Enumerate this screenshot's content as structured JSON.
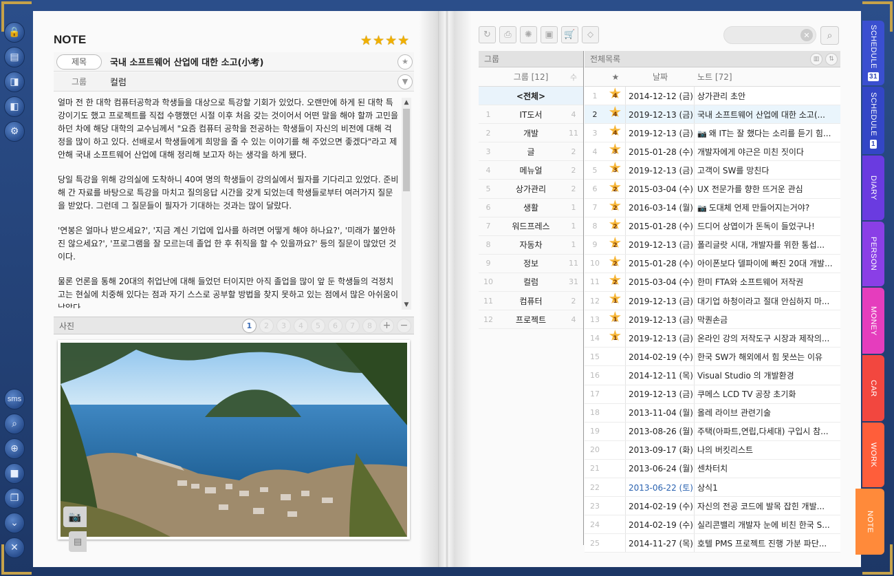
{
  "left_tools": [
    {
      "name": "lock-icon",
      "glyph": "🔒"
    },
    {
      "name": "book-icon",
      "glyph": "▤"
    },
    {
      "name": "page-right-icon",
      "glyph": "◨"
    },
    {
      "name": "page-left-icon",
      "glyph": "◧"
    },
    {
      "name": "gear-icon",
      "glyph": "⚙"
    }
  ],
  "left_tools_bottom": [
    {
      "name": "sms-button",
      "label": "sms"
    },
    {
      "name": "search-icon",
      "label": "⌕"
    },
    {
      "name": "zoom-settings-icon",
      "label": "⊕"
    },
    {
      "name": "window-icon",
      "label": "■"
    },
    {
      "name": "window-restore-icon",
      "label": "❐"
    },
    {
      "name": "chevrons-down-icon",
      "label": "⌄"
    },
    {
      "name": "close-icon",
      "label": "✕"
    }
  ],
  "note": {
    "heading": "NOTE",
    "star_count": 4,
    "title_label": "제목",
    "title_value": "국내 소프트웨어 산업에 대한 소고(小考)",
    "group_label": "그룹",
    "group_value": "컬럼",
    "paragraphs": [
      "얼마 전 한 대학 컴퓨터공학과 학생들을 대상으로 특강할 기회가 있었다. 오랜만에 하게 된 대학 특강이기도 했고 프로젝트를 직접 수행했던 시절 이후 처음 갖는 것이어서 어떤 말을 해야 할까 고민을 하던 차에 해당 대학의 교수님께서 \"요즘 컴퓨터 공학을 전공하는 학생들이 자신의 비전에 대해 걱정을 많이 하고 있다. 선배로서 학생들에게 희망을 줄 수 있는 이야기를 해 주었으면 좋겠다\"라고 제안해 국내 소프트웨어 산업에 대해 정리해 보고자 하는 생각을 하게 됐다.",
      "당일 특강을 위해 강의실에 도착하니 40여 명의 학생들이 강의실에서 필자를 기다리고 있었다. 준비해 간 자료를 바탕으로 특강을 마치고 질의응답 시간을 갖게 되었는데 학생들로부터 여러가지 질문을 받았다. 그런데 그 질문들이 필자가 기대하는 것과는 많이 달랐다.",
      "'연봉은 얼마나 받으세요?', '지금 계신 기업에 입사를 하려면 어떻게 해야 하나요?', '미래가 불안하진 않으세요?', '프로그램을 잘 모르는데 졸업 한 후 취직을 할 수 있을까요?' 등의 질문이 많았던 것이다.",
      "물론 언론을 통해 20대의 취업난에 대해 들었던 터이지만 아직 졸업을 많이 앞 둔 학생들의 걱정치고는 현실에 치중해 있다는 점과 자기 스스로 공부할 방법을 찾지 못하고 있는 점에서 많은 아쉬움이 남았다."
    ],
    "photo_label": "사진",
    "photo_pages": [
      "1",
      "2",
      "3",
      "4",
      "5",
      "6",
      "7",
      "8"
    ],
    "photo_active_page": "1",
    "add_label": "+",
    "remove_label": "−"
  },
  "toolbar": [
    {
      "name": "refresh-icon",
      "glyph": "↻"
    },
    {
      "name": "print-icon",
      "glyph": "⎙"
    },
    {
      "name": "loading-icon",
      "glyph": "✺"
    },
    {
      "name": "save-icon",
      "glyph": "▣"
    },
    {
      "name": "cart-icon",
      "glyph": "🛒"
    },
    {
      "name": "tag-icon",
      "glyph": "⬦"
    }
  ],
  "search": {
    "placeholder": "",
    "clear": "✕",
    "button": "⌕"
  },
  "groups": {
    "panel_title": "그룹",
    "col_name": "그룹 [12]",
    "col_count": "수",
    "all_label": "<전체>",
    "items": [
      {
        "num": "1",
        "name": "IT도서",
        "count": "4"
      },
      {
        "num": "2",
        "name": "개발",
        "count": "11"
      },
      {
        "num": "3",
        "name": "글",
        "count": "2"
      },
      {
        "num": "4",
        "name": "메뉴얼",
        "count": "2"
      },
      {
        "num": "5",
        "name": "상가관리",
        "count": "2"
      },
      {
        "num": "6",
        "name": "생활",
        "count": "1"
      },
      {
        "num": "7",
        "name": "워드프레스",
        "count": "1"
      },
      {
        "num": "8",
        "name": "자동차",
        "count": "1"
      },
      {
        "num": "9",
        "name": "정보",
        "count": "11"
      },
      {
        "num": "10",
        "name": "컬럼",
        "count": "31"
      },
      {
        "num": "11",
        "name": "컴퓨터",
        "count": "2"
      },
      {
        "num": "12",
        "name": "프로젝트",
        "count": "4"
      }
    ]
  },
  "notes": {
    "panel_title": "전체목록",
    "col_star": "★",
    "col_date": "날짜",
    "col_title": "노트 [72]",
    "rows": [
      {
        "num": "1",
        "stars": "4",
        "date": "2014-12-12 (금)",
        "title": "상가관리 초안",
        "photo": false
      },
      {
        "num": "2",
        "stars": "4",
        "date": "2019-12-13 (금)",
        "title": "국내 소프트웨어 산업에 대한 소고(...",
        "photo": false
      },
      {
        "num": "3",
        "stars": "4",
        "date": "2019-12-13 (금)",
        "title": "왜 IT는 잘 했다는 소리를 듣기 힘...",
        "photo": true
      },
      {
        "num": "4",
        "stars": "3",
        "date": "2015-01-28 (수)",
        "title": "개발자에게 야근은 미친 짓이다",
        "photo": false
      },
      {
        "num": "5",
        "stars": "3",
        "date": "2019-12-13 (금)",
        "title": "고객이 SW를 망친다",
        "photo": false
      },
      {
        "num": "6",
        "stars": "2",
        "date": "2015-03-04 (수)",
        "title": "UX 전문가를 향한 뜨거운 관심",
        "photo": false
      },
      {
        "num": "7",
        "stars": "2",
        "date": "2016-03-14 (월)",
        "title": "도대체 언제 만들어지는거야?",
        "photo": true
      },
      {
        "num": "8",
        "stars": "2",
        "date": "2015-01-28 (수)",
        "title": "드디어 상엽이가 돈독이 들었구나!",
        "photo": false
      },
      {
        "num": "9",
        "stars": "2",
        "date": "2019-12-13 (금)",
        "title": "폴리글랏 시대, 개발자를 위한 통섭...",
        "photo": false
      },
      {
        "num": "10",
        "stars": "2",
        "date": "2015-01-28 (수)",
        "title": "아이폰보다 델파이에 빠진 20대 개발...",
        "photo": false
      },
      {
        "num": "11",
        "stars": "2",
        "date": "2015-03-04 (수)",
        "title": "한미 FTA와 소프트웨어 저작권",
        "photo": false
      },
      {
        "num": "12",
        "stars": "1",
        "date": "2019-12-13 (금)",
        "title": "대기업 하청이라고 절대 안심하지 마...",
        "photo": false
      },
      {
        "num": "13",
        "stars": "1",
        "date": "2019-12-13 (금)",
        "title": "막퀀손금",
        "photo": false
      },
      {
        "num": "14",
        "stars": "1",
        "date": "2019-12-13 (금)",
        "title": "온라인 강의 저작도구 시장과 제작의...",
        "photo": false
      },
      {
        "num": "15",
        "stars": "",
        "date": "2014-02-19 (수)",
        "title": "한국 SW가 해외에서 힘 못쓰는 이유",
        "photo": false
      },
      {
        "num": "16",
        "stars": "",
        "date": "2014-12-11 (목)",
        "title": "Visual Studio 의 개발환경",
        "photo": false
      },
      {
        "num": "17",
        "stars": "",
        "date": "2019-12-13 (금)",
        "title": "쿠메스 LCD TV 공장 초기화",
        "photo": false
      },
      {
        "num": "18",
        "stars": "",
        "date": "2013-11-04 (월)",
        "title": "올레 라이브 관련기술",
        "photo": false
      },
      {
        "num": "19",
        "stars": "",
        "date": "2013-08-26 (월)",
        "title": "주택(아파트,연립,다세대) 구입시 참...",
        "photo": false
      },
      {
        "num": "20",
        "stars": "",
        "date": "2013-09-17 (화)",
        "title": "나의 버킷리스트",
        "photo": false
      },
      {
        "num": "21",
        "stars": "",
        "date": "2013-06-24 (월)",
        "title": "센차터치",
        "photo": false
      },
      {
        "num": "22",
        "stars": "",
        "date": "2013-06-22 (토)",
        "title": "상식1",
        "photo": false,
        "blue": true
      },
      {
        "num": "23",
        "stars": "",
        "date": "2014-02-19 (수)",
        "title": "자신의 전공 코드에 발목 잡힌 개발...",
        "photo": false
      },
      {
        "num": "24",
        "stars": "",
        "date": "2014-02-19 (수)",
        "title": "실리콘밸리 개발자 눈에 비친 한국 S...",
        "photo": false
      },
      {
        "num": "25",
        "stars": "",
        "date": "2014-11-27 (목)",
        "title": "호텔 PMS 프로젝트 진행 가분 파단...",
        "photo": false
      }
    ]
  },
  "tabs": [
    {
      "label": "SCHEDULE",
      "badge": "31",
      "color": "#3a4fd0"
    },
    {
      "label": "SCHEDULE",
      "badge": "1",
      "color": "#3346c6"
    },
    {
      "label": "DIARY",
      "badge": "",
      "color": "#6a3be0"
    },
    {
      "label": "PERSON",
      "badge": "",
      "color": "#8a3fe6"
    },
    {
      "label": "MONEY",
      "badge": "",
      "color": "#e53dbd"
    },
    {
      "label": "CAR",
      "badge": "",
      "color": "#f2473f"
    },
    {
      "label": "WORK",
      "badge": "",
      "color": "#ff5e3a"
    },
    {
      "label": "NOTE",
      "badge": "",
      "color": "#ff8a3a"
    }
  ]
}
